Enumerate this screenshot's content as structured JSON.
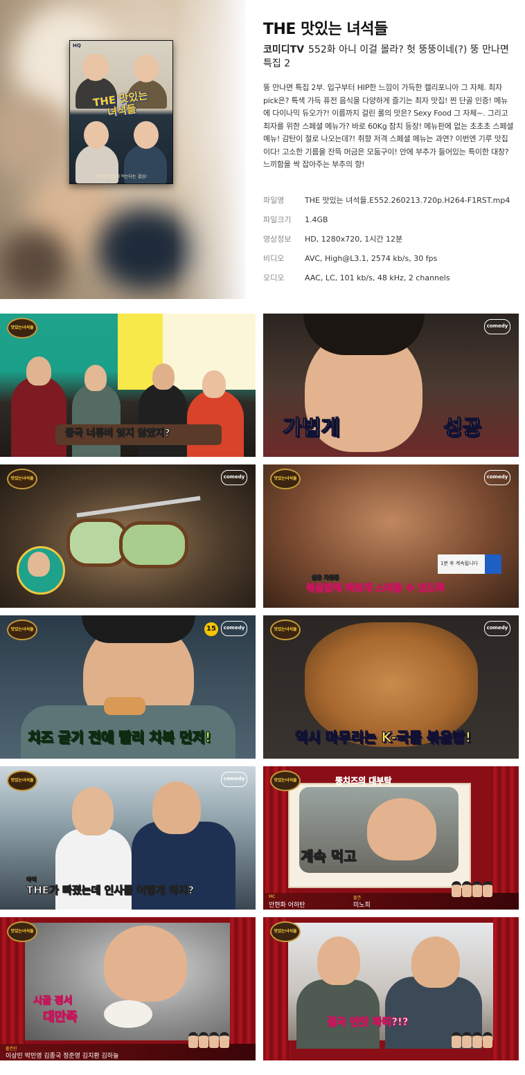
{
  "show": {
    "title": "THE 맛있는 녀석들",
    "channel": "코미디TV",
    "episode_title": "552화 아니 이걸 몰라? 헛 뚱뚱이네(?) 뚱 만나면 특집 2",
    "description": "뚱 만나면 특집 2부. 입구부터 HIP한 느낌이 가득한 캘리포니아 그 자체. 최자 pick은? 특색 가득 퓨전 음식을 다양하게 즐기는 최자 맛집! 찐 단골 인증! 메뉴에 다이나믹 듀오가?! 이름까지 걸린 롤의 맛은? Sexy Food 그 자체~. 그리고 최자를 위한 스페셜 메뉴가? 바로 60Kg 참치 등장! 메뉴판에 없는 초초초 스페셜 메뉴! 감탄이 절로 나오는데?! 취향 저격 스페셜 메뉴는 과연? 이번엔 기루 맛집이다! 고소한 기름을 잔뜩 머금은 모둠구이! 안에 부추가 들어있는 특이한 대창? 느끼함을 싹 잡아주는 부추의 향!"
  },
  "poster": {
    "hq_label": "HQ",
    "title_art": "THE 맛있는 녀석들",
    "tagline": "무조건 맛있게 먹는다는 결심!"
  },
  "file_info": [
    {
      "label": "파일명",
      "value": "THE 맛있는 녀석들.E552.260213.720p.H264-F1RST.mp4"
    },
    {
      "label": "파일크기",
      "value": "1.4GB"
    },
    {
      "label": "영상정보",
      "value": "HD, 1280x720, 1시간 12분"
    },
    {
      "label": "비디오",
      "value": "AVC, High@L3.1, 2574 kb/s, 30 fps"
    },
    {
      "label": "오디오",
      "value": "AAC, LC, 101 kb/s, 48 kHz, 2 channels"
    }
  ],
  "screenshots": {
    "logo_text": "맛있는녀석들",
    "channel_badge": "comedy",
    "rating": "15",
    "s1_caption": "중국 너튜버 잊지 않았지?",
    "s2_caption_left": "가볍게",
    "s2_caption_right": "성공",
    "s4_caption_small": "쉽은 차원통",
    "s4_caption": "볶음밥에 빠르게 스며들 수 있도록",
    "s4_next": "1분 후 계속됩니다",
    "s5_caption": "치즈 굳기 전에 빨리 치복 먼저!",
    "s6_caption": "역시 마무리는 K-국룰 볶음밥!",
    "s7_caption_small": "아이",
    "s7_caption": "THE가 빠졌는데 인사를 어떻게 하지?",
    "s8_title": "뚱치즈의 대부탁",
    "s8_caption": "계속 먹고",
    "s8_credit_tag1": "MC",
    "s8_credit1": "안현화 어하탄",
    "s8_credit_tag2": "출연",
    "s8_credit2": "미노희",
    "s9_caption1": "시골 정서",
    "s9_caption2": "대만족",
    "s9_lower_tag": "출연진",
    "s9_lower": "이상민 박민영 김종국 정준영 김지환 김하늘",
    "s10_caption": "결국 먼맛 파티?!?"
  }
}
